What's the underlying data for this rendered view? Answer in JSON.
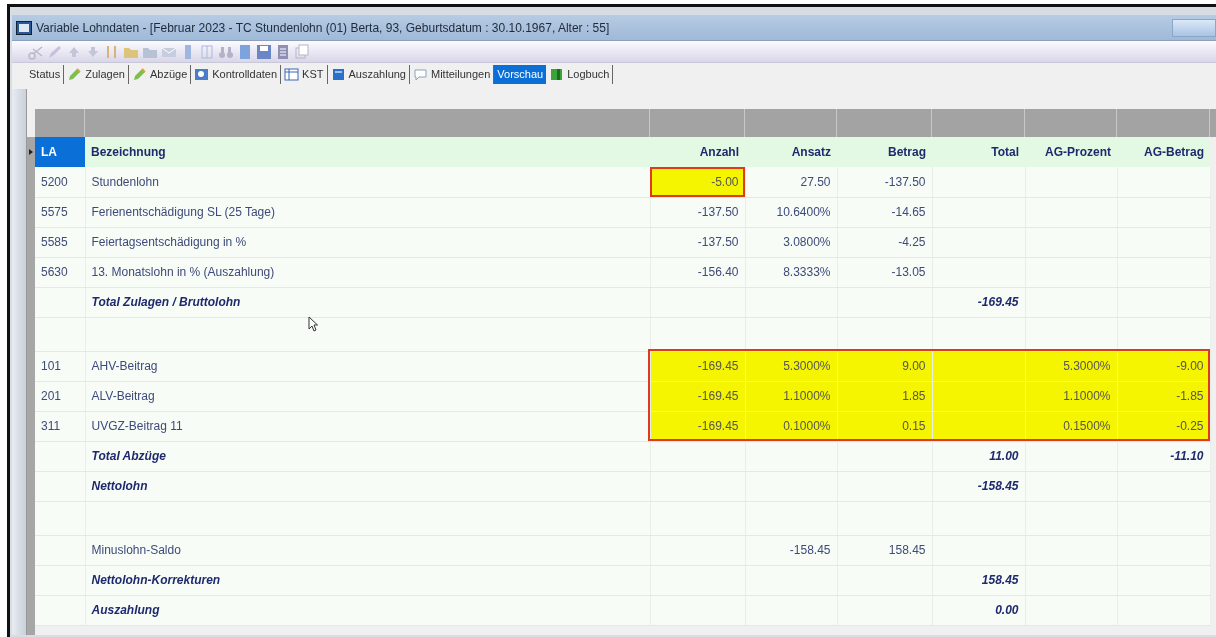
{
  "window": {
    "title": "Variable Lohndaten - [Februar 2023 - TC Stundenlohn (01) Berta, 93, Geburtsdatum : 30.10.1967, Alter : 55]"
  },
  "tabs": [
    {
      "label": "Status",
      "selected": false
    },
    {
      "label": "Zulagen",
      "selected": false
    },
    {
      "label": "Abzüge",
      "selected": false
    },
    {
      "label": "Kontrolldaten",
      "selected": false
    },
    {
      "label": "KST",
      "selected": false
    },
    {
      "label": "Auszahlung",
      "selected": false
    },
    {
      "label": "Mitteilungen",
      "selected": false
    },
    {
      "label": "Vorschau",
      "selected": true
    },
    {
      "label": "Logbuch",
      "selected": false
    }
  ],
  "table": {
    "columns": [
      {
        "label": "LA",
        "selected": true
      },
      {
        "label": "Bezeichnung",
        "selected": false
      },
      {
        "label": "Anzahl",
        "selected": false
      },
      {
        "label": "Ansatz",
        "selected": false
      },
      {
        "label": "Betrag",
        "selected": false
      },
      {
        "label": "Total",
        "selected": false
      },
      {
        "label": "AG-Prozent",
        "selected": false
      },
      {
        "label": "AG-Betrag",
        "selected": false
      }
    ],
    "rows": [
      {
        "kind": "item",
        "la": "5200",
        "name": "Stundenlohn",
        "values": {
          "anzahl": "-5.00",
          "ansatz": "27.50",
          "betrag": "-137.50"
        },
        "anzahl_highlighted": true,
        "values_highlighted": false
      },
      {
        "kind": "item",
        "la": "5575",
        "name": "Ferienentschädigung SL (25 Tage)",
        "values": {
          "anzahl": "-137.50",
          "ansatz": "10.6400%",
          "betrag": "-14.65"
        },
        "anzahl_highlighted": false,
        "values_highlighted": false
      },
      {
        "kind": "item",
        "la": "5585",
        "name": "Feiertagsentschädigung in %",
        "values": {
          "anzahl": "-137.50",
          "ansatz": "3.0800%",
          "betrag": "-4.25"
        },
        "anzahl_highlighted": false,
        "values_highlighted": false
      },
      {
        "kind": "item",
        "la": "5630",
        "name": "13. Monatslohn in % (Auszahlung)",
        "values": {
          "anzahl": "-156.40",
          "ansatz": "8.3333%",
          "betrag": "-13.05"
        },
        "anzahl_highlighted": false,
        "values_highlighted": false
      },
      {
        "kind": "total",
        "name": "Total Zulagen / Bruttolohn",
        "values": {
          "total": "-169.45"
        },
        "anzahl_highlighted": false,
        "values_highlighted": false
      },
      {
        "kind": "blank",
        "anzahl_highlighted": false,
        "values_highlighted": false
      },
      {
        "kind": "item",
        "la": "101",
        "name": "AHV-Beitrag",
        "values": {
          "anzahl": "-169.45",
          "ansatz": "5.3000%",
          "betrag": "9.00",
          "ag_prozent": "5.3000%",
          "ag_betrag": "-9.00"
        },
        "anzahl_highlighted": false,
        "values_highlighted": true
      },
      {
        "kind": "item",
        "la": "201",
        "name": "ALV-Beitrag",
        "values": {
          "anzahl": "-169.45",
          "ansatz": "1.1000%",
          "betrag": "1.85",
          "ag_prozent": "1.1000%",
          "ag_betrag": "-1.85"
        },
        "anzahl_highlighted": false,
        "values_highlighted": true
      },
      {
        "kind": "item",
        "la": "311",
        "name": "UVGZ-Beitrag 11",
        "values": {
          "anzahl": "-169.45",
          "ansatz": "0.1000%",
          "betrag": "0.15",
          "ag_prozent": "0.1500%",
          "ag_betrag": "-0.25"
        },
        "anzahl_highlighted": false,
        "values_highlighted": true
      },
      {
        "kind": "total",
        "name": "Total Abzüge",
        "values": {
          "total": "11.00",
          "ag_betrag": "-11.10"
        },
        "anzahl_highlighted": false,
        "values_highlighted": false
      },
      {
        "kind": "total",
        "name": "Nettolohn",
        "values": {
          "total": "-158.45"
        },
        "anzahl_highlighted": false,
        "values_highlighted": false
      },
      {
        "kind": "blank",
        "anzahl_highlighted": false,
        "values_highlighted": false
      },
      {
        "kind": "item",
        "name": "Minuslohn-Saldo",
        "values": {
          "ansatz": "-158.45",
          "betrag": "158.45"
        },
        "anzahl_highlighted": false,
        "values_highlighted": false
      },
      {
        "kind": "total",
        "name": "Nettolohn-Korrekturen",
        "values": {
          "total": "158.45"
        },
        "anzahl_highlighted": false,
        "values_highlighted": false
      },
      {
        "kind": "total",
        "name": "Auszahlung",
        "values": {
          "total": "0.00"
        },
        "anzahl_highlighted": false,
        "values_highlighted": false
      }
    ]
  }
}
